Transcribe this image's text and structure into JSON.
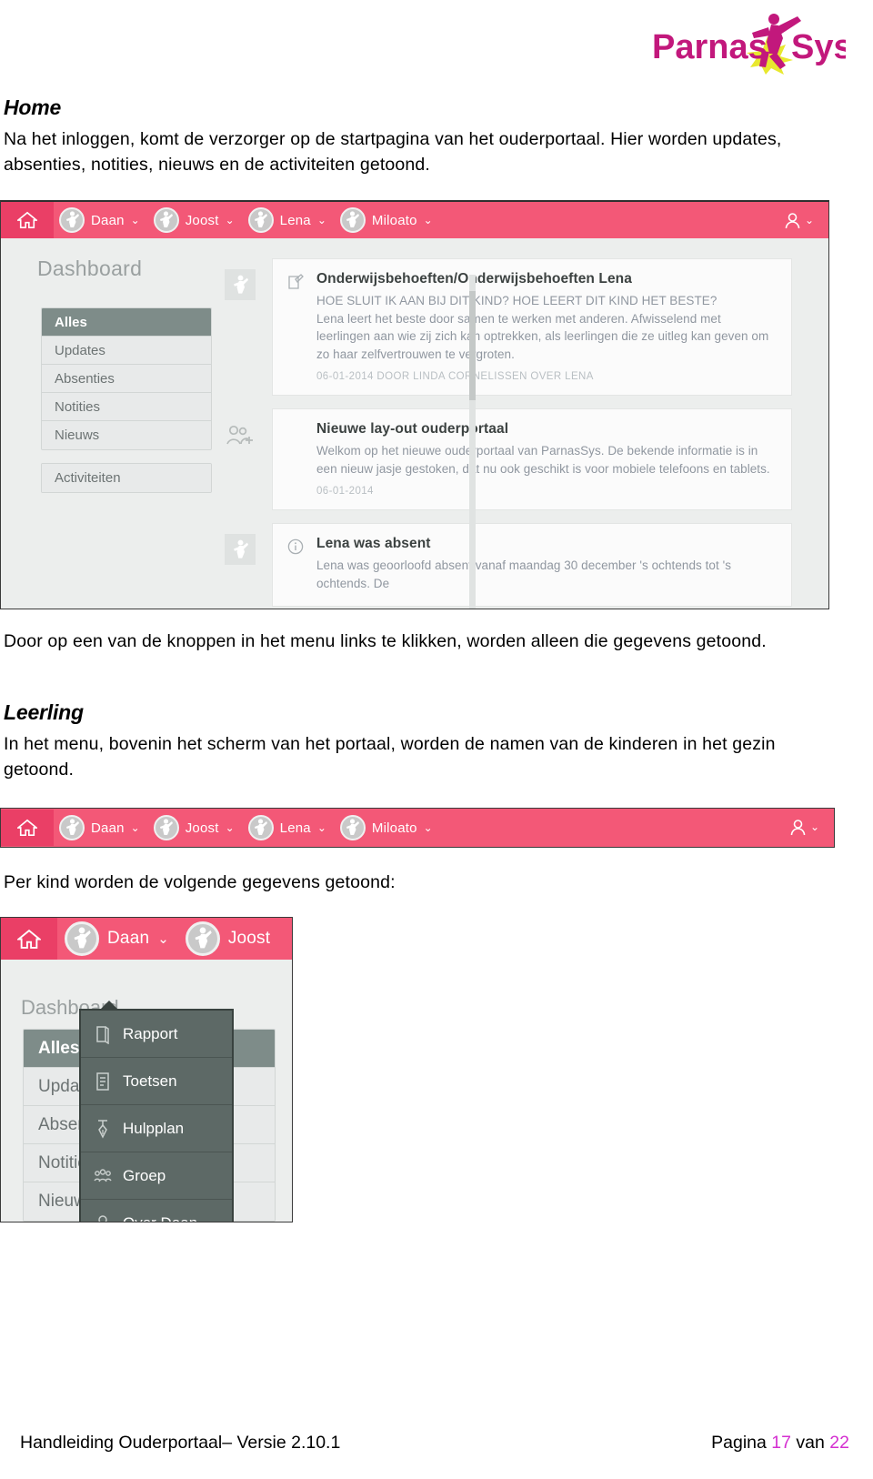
{
  "brand": {
    "name_part1": "Parnas",
    "name_part2": "Sys",
    "color": "#c2187c",
    "accent_color": "#e8e82e"
  },
  "sections": {
    "home": {
      "heading": "Home",
      "body": "Na het inloggen, komt de verzorger op de startpagina van het ouderportaal. Hier worden updates, absenties, notities, nieuws en de activiteiten getoond."
    },
    "door": {
      "body": "Door op een van de knoppen in het menu links te klikken, worden alleen die gegevens getoond."
    },
    "leerling": {
      "heading": "Leerling",
      "body": "In het menu, bovenin het scherm van het portaal, worden de namen van de kinderen in het gezin getoond."
    },
    "perkind": {
      "body": "Per kind worden de volgende gegevens getoond:"
    }
  },
  "portal": {
    "navbar": {
      "home_icon": "home-icon",
      "user_icon": "user-account-icon",
      "children": [
        {
          "name": "Daan",
          "avatar_icon": "child-avatar-icon",
          "chevron": "⌄"
        },
        {
          "name": "Joost",
          "avatar_icon": "child-avatar-icon",
          "chevron": "⌄"
        },
        {
          "name": "Lena",
          "avatar_icon": "child-avatar-icon",
          "chevron": "⌄"
        },
        {
          "name": "Miloato",
          "avatar_icon": "child-avatar-icon",
          "chevron": "⌄"
        }
      ]
    },
    "dashboard": {
      "title": "Dashboard",
      "menu_primary": [
        {
          "label": "Alles",
          "active": true
        },
        {
          "label": "Updates",
          "active": false
        },
        {
          "label": "Absenties",
          "active": false
        },
        {
          "label": "Notities",
          "active": false
        },
        {
          "label": "Nieuws",
          "active": false
        }
      ],
      "menu_secondary": [
        {
          "label": "Activiteiten",
          "active": false
        }
      ],
      "feed": [
        {
          "icon": "edit-note-icon",
          "stub_icon": "child-avatar-icon",
          "title": "Onderwijsbehoeften/Onderwijsbehoeften Lena",
          "body_line1": "HOE SLUIT IK AAN BIJ DIT KIND? HOE LEERT DIT KIND HET BESTE?",
          "body_line2": "Lena leert het beste door samen te werken met anderen. Afwisselend met leerlingen aan wie zij zich kan optrekken, als leerlingen die ze uitleg kan geven om zo haar zelfvertrouwen te vergroten.",
          "meta": "06-01-2014 DOOR LINDA CORNELISSEN OVER LENA"
        },
        {
          "icon": "",
          "stub_icon": "add-people-icon",
          "title": "Nieuwe lay-out ouderportaal",
          "body_line1": "Welkom op het nieuwe ouderportaal van ParnasSys. De bekende informatie is in een nieuw jasje gestoken, dat nu ook geschikt is voor mobiele telefoons en tablets.",
          "body_line2": "",
          "meta": "06-01-2014"
        },
        {
          "icon": "info-circle-icon",
          "stub_icon": "child-avatar-icon",
          "title": "Lena was absent",
          "body_line1": "Lena was geoorloofd absent vanaf maandag 30 december 's ochtends tot 's ochtends. De",
          "body_line2": "",
          "meta": ""
        }
      ]
    },
    "child_dropdown": {
      "owner": "Daan",
      "items": [
        {
          "label": "Rapport",
          "icon": "book-icon"
        },
        {
          "label": "Toetsen",
          "icon": "document-icon"
        },
        {
          "label": "Hulpplan",
          "icon": "pen-icon"
        },
        {
          "label": "Groep",
          "icon": "group-people-icon"
        },
        {
          "label": "Over Daan",
          "icon": "person-icon"
        }
      ]
    }
  },
  "footer": {
    "left": "Handleiding Ouderportaal– Versie 2.10.1",
    "pagina_label": "Pagina",
    "page_current": "17",
    "van_label": "van",
    "page_total": "22"
  }
}
